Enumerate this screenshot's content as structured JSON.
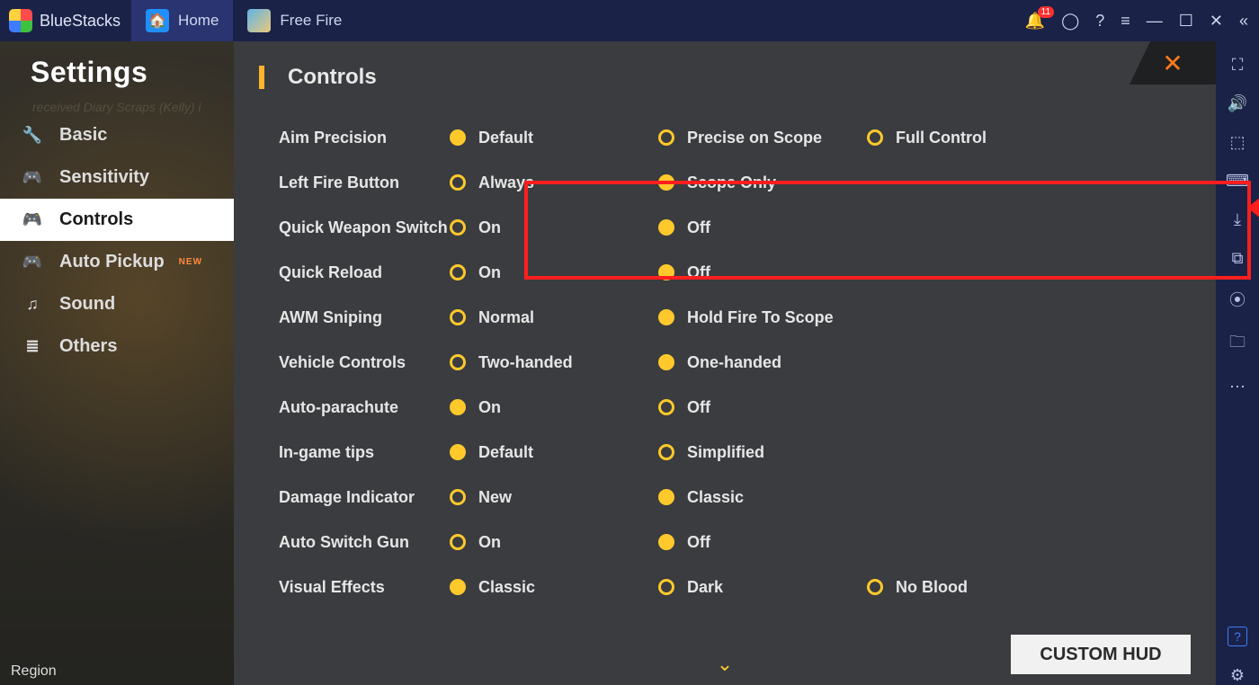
{
  "titlebar": {
    "brand": "BlueStacks",
    "tabs": [
      {
        "label": "Home",
        "icon": "home"
      },
      {
        "label": "Free Fire",
        "icon": "ff"
      }
    ],
    "notification_count": "11"
  },
  "sidebar": {
    "title": "Settings",
    "faded_text": "received Diary Scraps (Kelly) i",
    "items": [
      {
        "label": "Basic",
        "icon": "🔧",
        "active": false
      },
      {
        "label": "Sensitivity",
        "icon": "🎮",
        "active": false
      },
      {
        "label": "Controls",
        "icon": "🎮",
        "active": true
      },
      {
        "label": "Auto Pickup",
        "icon": "🎮",
        "active": false,
        "new": "NEW"
      },
      {
        "label": "Sound",
        "icon": "♫",
        "active": false
      },
      {
        "label": "Others",
        "icon": "≣",
        "active": false
      }
    ],
    "region_label": "Region"
  },
  "panel": {
    "section_title": "Controls",
    "rows": [
      {
        "label": "Aim Precision",
        "opts": [
          "Default",
          "Precise on Scope",
          "Full Control"
        ],
        "sel": 0
      },
      {
        "label": "Left Fire Button",
        "opts": [
          "Always",
          "Scope Only"
        ],
        "sel": 1
      },
      {
        "label": "Quick Weapon Switch",
        "opts": [
          "On",
          "Off"
        ],
        "sel": 1
      },
      {
        "label": "Quick Reload",
        "opts": [
          "On",
          "Off"
        ],
        "sel": 1
      },
      {
        "label": "AWM Sniping",
        "opts": [
          "Normal",
          "Hold Fire To Scope"
        ],
        "sel": 1
      },
      {
        "label": "Vehicle Controls",
        "opts": [
          "Two-handed",
          "One-handed"
        ],
        "sel": 1
      },
      {
        "label": "Auto-parachute",
        "opts": [
          "On",
          "Off"
        ],
        "sel": 0
      },
      {
        "label": "In-game tips",
        "opts": [
          "Default",
          "Simplified"
        ],
        "sel": 0
      },
      {
        "label": "Damage Indicator",
        "opts": [
          "New",
          "Classic"
        ],
        "sel": 1
      },
      {
        "label": "Auto Switch Gun",
        "opts": [
          "On",
          "Off"
        ],
        "sel": 1
      },
      {
        "label": "Visual Effects",
        "opts": [
          "Classic",
          "Dark",
          "No Blood"
        ],
        "sel": 0
      }
    ],
    "custom_hud": "CUSTOM HUD"
  }
}
